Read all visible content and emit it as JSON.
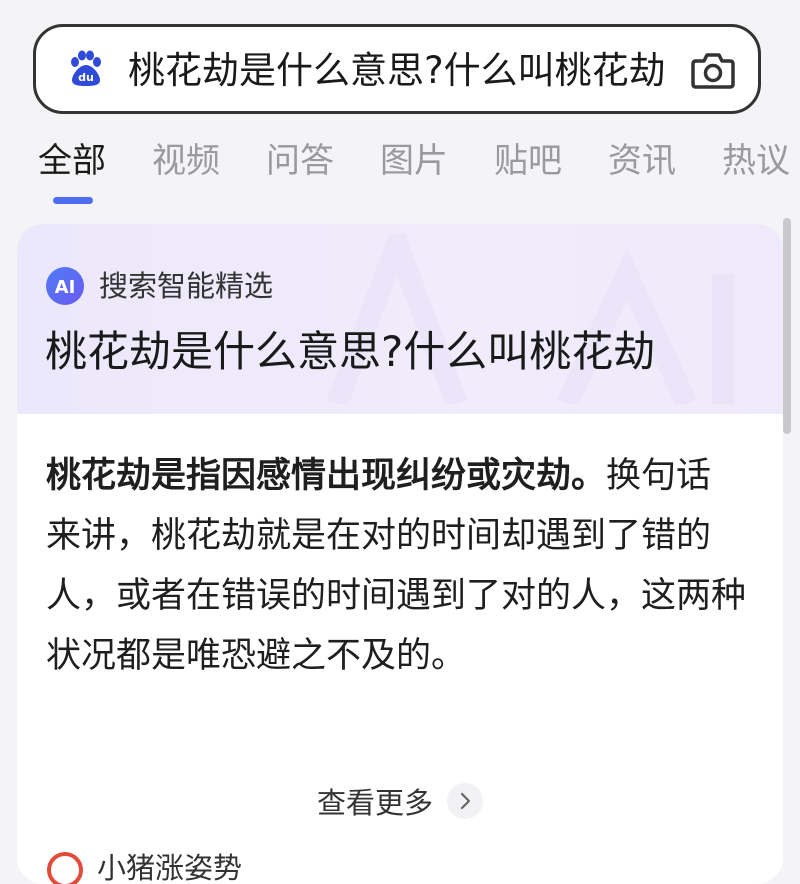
{
  "search": {
    "query": "桃花劫是什么意思?什么叫桃花劫",
    "logo_icon": "baidu-paw-logo",
    "camera_icon": "camera-icon"
  },
  "tabs": [
    {
      "label": "全部",
      "active": true
    },
    {
      "label": "视频",
      "active": false
    },
    {
      "label": "问答",
      "active": false
    },
    {
      "label": "图片",
      "active": false
    },
    {
      "label": "贴吧",
      "active": false
    },
    {
      "label": "资讯",
      "active": false
    },
    {
      "label": "热议",
      "active": false
    }
  ],
  "ai_card": {
    "badge_text": "AI",
    "label": "搜索智能精选",
    "title": "桃花劫是什么意思?什么叫桃花劫",
    "answer_bold": "桃花劫是指因感情出现纠纷或灾劫。",
    "answer_rest": "换句话来讲，桃花劫就是在对的时间却遇到了错的人，或者在错误的时间遇到了对的人，这两种状况都是唯恐避之不及的。",
    "see_more": "查看更多",
    "source_name": "小猪涨姿势"
  },
  "colors": {
    "accent": "#4e6ef2",
    "ai_header_bg": "#ece8fb",
    "source_icon": "#e24a3b"
  }
}
